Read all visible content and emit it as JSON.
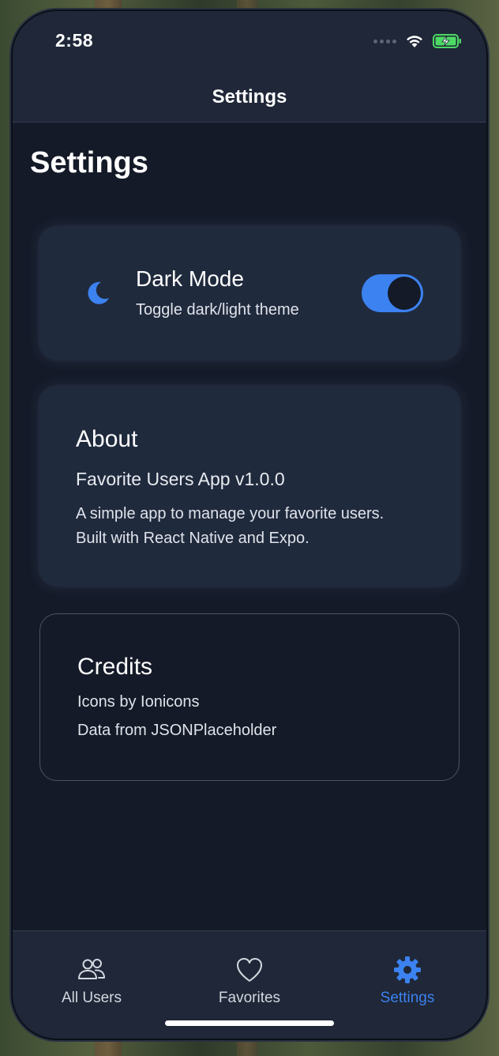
{
  "status_bar": {
    "time": "2:58",
    "icons": [
      "signal-dots-icon",
      "wifi-icon",
      "battery-charging-icon"
    ]
  },
  "header": {
    "title": "Settings"
  },
  "page": {
    "title": "Settings"
  },
  "dark_mode": {
    "icon": "moon-icon",
    "title": "Dark Mode",
    "subtitle": "Toggle dark/light theme",
    "enabled": true
  },
  "about": {
    "title": "About",
    "version": "Favorite Users App v1.0.0",
    "description": "A simple app to manage your favorite users. Built with React Native and Expo."
  },
  "credits": {
    "title": "Credits",
    "lines": [
      "Icons by Ionicons",
      "Data from JSONPlaceholder"
    ]
  },
  "tabs": [
    {
      "label": "All Users",
      "icon": "people-icon",
      "active": false
    },
    {
      "label": "Favorites",
      "icon": "heart-icon",
      "active": false
    },
    {
      "label": "Settings",
      "icon": "gear-icon",
      "active": true
    }
  ],
  "colors": {
    "accent": "#3c82f0",
    "background": "#141a28",
    "surface": "#202a3d",
    "header": "#1f2738",
    "battery": "#4cd964"
  }
}
